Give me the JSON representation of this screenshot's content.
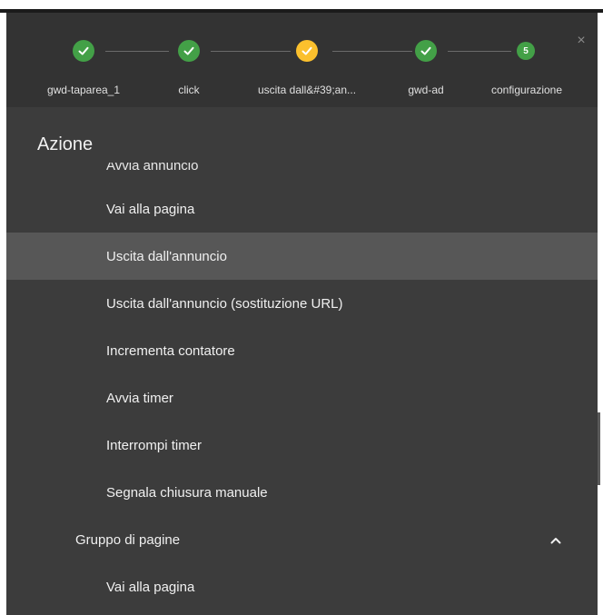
{
  "stepper": {
    "steps": [
      {
        "label": "gwd-taparea_1",
        "state": "done"
      },
      {
        "label": "click",
        "state": "done"
      },
      {
        "label": "uscita dall&#39;an...",
        "state": "active"
      },
      {
        "label": "gwd-ad",
        "state": "done"
      },
      {
        "label": "configurazione",
        "state": "current",
        "number": "5"
      }
    ],
    "close_label": "×"
  },
  "panel": {
    "title": "Azione",
    "cut_item": "Avvia annuncio",
    "items": [
      {
        "label": "Vai alla pagina"
      },
      {
        "label": "Uscita dall'annuncio"
      },
      {
        "label": "Uscita dall'annuncio (sostituzione URL)"
      },
      {
        "label": "Incrementa contatore"
      },
      {
        "label": "Avvia timer"
      },
      {
        "label": "Interrompi timer"
      },
      {
        "label": "Segnala chiusura manuale"
      }
    ],
    "group": {
      "label": "Gruppo di pagine",
      "expanded": true,
      "items": [
        {
          "label": "Vai alla pagina"
        }
      ]
    },
    "highlighted_item": "Uscita dall'annuncio"
  },
  "colors": {
    "done": "#43a047",
    "active": "#fbc02d",
    "dialog_bg": "#3c3c3c",
    "highlight_bg": "#575757"
  }
}
